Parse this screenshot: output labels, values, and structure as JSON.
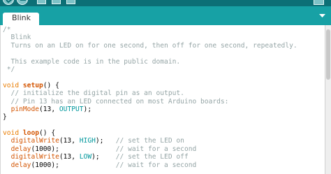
{
  "window": {
    "tab_name": "Blink",
    "colors": {
      "toolbar": "#0c6f76",
      "tab_bar": "#17a1a5",
      "comment": "#95a5a6",
      "keyword": "#e97c00",
      "function": "#d35400",
      "constant": "#00979c"
    }
  },
  "toolbar": {
    "buttons": [
      "verify-icon",
      "upload-icon",
      "new-icon",
      "open-icon",
      "save-icon",
      "serial-monitor-icon"
    ]
  },
  "code": {
    "lines": [
      {
        "parts": [
          {
            "t": "/*",
            "c": "cm"
          }
        ]
      },
      {
        "parts": [
          {
            "t": "  Blink",
            "c": "cm"
          }
        ]
      },
      {
        "parts": [
          {
            "t": "  Turns on an LED on for one second, then off for one second, repeatedly.",
            "c": "cm"
          }
        ]
      },
      {
        "parts": [
          {
            "t": "",
            "c": ""
          }
        ]
      },
      {
        "parts": [
          {
            "t": "  This example code is in the public domain.",
            "c": "cm"
          }
        ]
      },
      {
        "parts": [
          {
            "t": " */",
            "c": "cm"
          }
        ]
      },
      {
        "parts": [
          {
            "t": "",
            "c": ""
          }
        ]
      },
      {
        "parts": [
          {
            "t": "void",
            "c": "kw"
          },
          {
            "t": " ",
            "c": ""
          },
          {
            "t": "setup",
            "c": "fnb"
          },
          {
            "t": "() {",
            "c": ""
          }
        ]
      },
      {
        "parts": [
          {
            "t": "  // initialize the digital pin as an output.",
            "c": "cm"
          }
        ]
      },
      {
        "parts": [
          {
            "t": "  // Pin 13 has an LED connected on most Arduino boards:",
            "c": "cm"
          }
        ]
      },
      {
        "parts": [
          {
            "t": "  ",
            "c": ""
          },
          {
            "t": "pinMode",
            "c": "fn"
          },
          {
            "t": "(13, ",
            "c": ""
          },
          {
            "t": "OUTPUT",
            "c": "ct"
          },
          {
            "t": ");",
            "c": ""
          }
        ]
      },
      {
        "parts": [
          {
            "t": "}",
            "c": ""
          }
        ]
      },
      {
        "parts": [
          {
            "t": "",
            "c": ""
          }
        ]
      },
      {
        "parts": [
          {
            "t": "void",
            "c": "kw"
          },
          {
            "t": " ",
            "c": ""
          },
          {
            "t": "loop",
            "c": "fnb"
          },
          {
            "t": "() {",
            "c": ""
          }
        ]
      },
      {
        "parts": [
          {
            "t": "  ",
            "c": ""
          },
          {
            "t": "digitalWrite",
            "c": "fn"
          },
          {
            "t": "(13, ",
            "c": ""
          },
          {
            "t": "HIGH",
            "c": "ct"
          },
          {
            "t": ");   ",
            "c": ""
          },
          {
            "t": "// set the LED on",
            "c": "cm"
          }
        ]
      },
      {
        "parts": [
          {
            "t": "  ",
            "c": ""
          },
          {
            "t": "delay",
            "c": "fn"
          },
          {
            "t": "(1000);              ",
            "c": ""
          },
          {
            "t": "// wait for a second",
            "c": "cm"
          }
        ]
      },
      {
        "parts": [
          {
            "t": "  ",
            "c": ""
          },
          {
            "t": "digitalWrite",
            "c": "fn"
          },
          {
            "t": "(13, ",
            "c": ""
          },
          {
            "t": "LOW",
            "c": "ct"
          },
          {
            "t": ");    ",
            "c": ""
          },
          {
            "t": "// set the LED off",
            "c": "cm"
          }
        ]
      },
      {
        "parts": [
          {
            "t": "  ",
            "c": ""
          },
          {
            "t": "delay",
            "c": "fn"
          },
          {
            "t": "(1000);              ",
            "c": ""
          },
          {
            "t": "// wait for a second",
            "c": "cm"
          }
        ]
      }
    ]
  }
}
